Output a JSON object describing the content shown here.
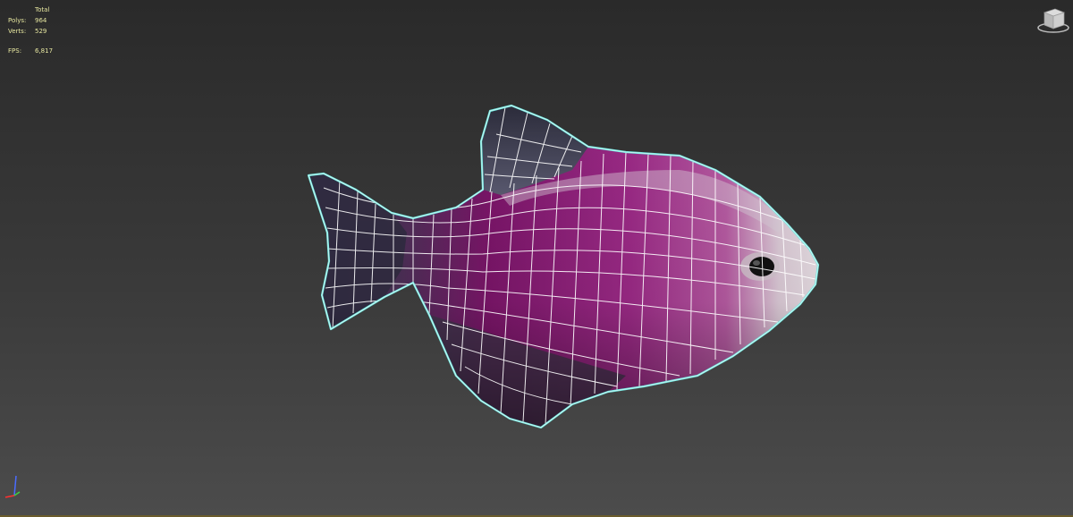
{
  "viewport": {
    "stats": {
      "header": "Total",
      "rows": [
        {
          "label": "Polys:",
          "value": "964"
        },
        {
          "label": "Verts:",
          "value": "529"
        },
        {
          "label": "FPS:",
          "value": "6,817"
        }
      ]
    },
    "viewcube_icon": "viewcube-icon",
    "axis_icon": "axis-tripod-icon",
    "model_icon": "fish-mesh",
    "colors": {
      "background_top": "#2a2a2a",
      "background_bottom": "#4c4c4c",
      "stats_text": "#e7e7a0",
      "selection_outline": "#6fe8e0",
      "wire": "#ffffff",
      "body_magenta": "#8a1a6e"
    }
  }
}
